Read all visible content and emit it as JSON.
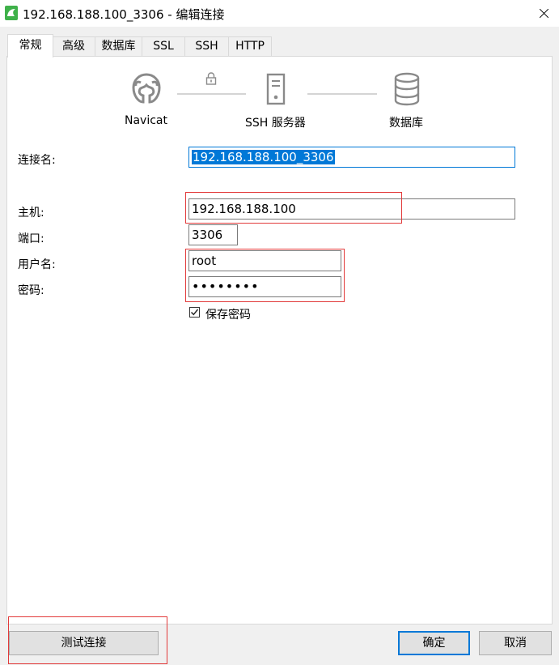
{
  "window": {
    "title": "192.168.188.100_3306 - 编辑连接",
    "close_icon": "close-icon"
  },
  "tabs": [
    "常规",
    "高级",
    "数据库",
    "SSL",
    "SSH",
    "HTTP"
  ],
  "diagram": {
    "navicat_label": "Navicat",
    "ssh_label": "SSH 服务器",
    "db_label": "数据库"
  },
  "form": {
    "connection_name_label": "连接名:",
    "connection_name": "192.168.188.100_3306",
    "host_label": "主机:",
    "host": "192.168.188.100",
    "port_label": "端口:",
    "port": "3306",
    "username_label": "用户名:",
    "username": "root",
    "password_label": "密码:",
    "password": "••••••••",
    "save_password_label": "保存密码",
    "save_password_checked": true
  },
  "buttons": {
    "test": "测试连接",
    "ok": "确定",
    "cancel": "取消"
  },
  "colors": {
    "accent": "#0078d7",
    "highlight_box": "#e23a3a",
    "app_icon": "#3fb14a"
  }
}
